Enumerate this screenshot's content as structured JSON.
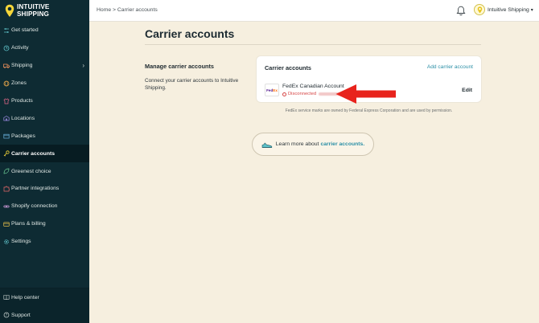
{
  "brand": {
    "line1": "INTUITIVE",
    "line2": "SHIPPING"
  },
  "sidebar": {
    "items": [
      {
        "label": "Get started",
        "icon": "sliders-icon"
      },
      {
        "label": "Activity",
        "icon": "activity-icon"
      },
      {
        "label": "Shipping",
        "icon": "truck-icon"
      },
      {
        "label": "Zones",
        "icon": "globe-icon"
      },
      {
        "label": "Products",
        "icon": "shirt-icon"
      },
      {
        "label": "Locations",
        "icon": "building-icon"
      },
      {
        "label": "Packages",
        "icon": "box-icon"
      },
      {
        "label": "Carrier accounts",
        "icon": "key-icon"
      },
      {
        "label": "Greenest choice",
        "icon": "leaf-icon"
      },
      {
        "label": "Partner integrations",
        "icon": "puzzle-icon"
      },
      {
        "label": "Shopify connection",
        "icon": "link-icon"
      },
      {
        "label": "Plans & billing",
        "icon": "card-icon"
      },
      {
        "label": "Settings",
        "icon": "gear-icon"
      }
    ],
    "bottom": [
      {
        "label": "Help center",
        "icon": "book-icon"
      },
      {
        "label": "Support",
        "icon": "question-icon"
      }
    ]
  },
  "header": {
    "breadcrumb": "Home > Carrier accounts",
    "user_name": "Intuitive Shipping"
  },
  "main": {
    "title": "Carrier accounts",
    "section_heading": "Manage carrier accounts",
    "section_desc": "Connect your carrier accounts to Intuitive Shipping.",
    "card": {
      "title": "Carrier accounts",
      "add_link": "Add carrier account",
      "account_name": "FedEx Canadian Account",
      "status": "Disconnected",
      "edit_label": "Edit",
      "logo_fe": "Fed",
      "logo_ex": "Ex"
    },
    "disclaimer": "FedEx service marks are owned by Federal Express Corporation and are used by permission.",
    "learn": {
      "prefix": "Learn more about",
      "link": "carrier accounts."
    }
  },
  "colors": {
    "sidebar_bg": "#0e2b33",
    "page_bg": "#f6efdf",
    "link": "#2b8fa6",
    "status_error": "#d64545",
    "annotation_arrow": "#e8231c"
  }
}
